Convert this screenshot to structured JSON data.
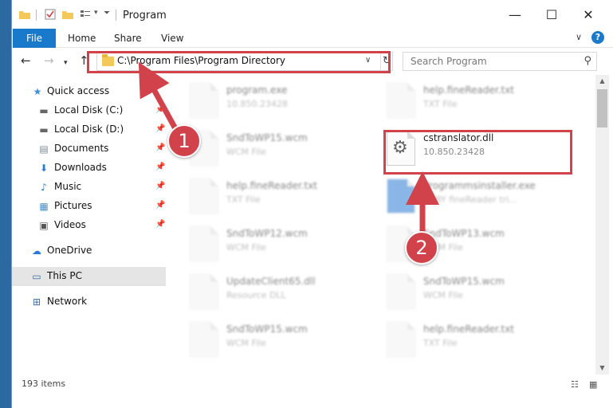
{
  "window": {
    "title": "Program",
    "controls": {
      "minimize": "—",
      "maximize": "☐",
      "close": "✕"
    }
  },
  "ribbon": {
    "tabs": [
      {
        "label": "File"
      },
      {
        "label": "Home"
      },
      {
        "label": "Share"
      },
      {
        "label": "View"
      }
    ]
  },
  "nav": {
    "address_path": "C:\\Program Files\\Program Directory",
    "search_placeholder": "Search Program"
  },
  "sidebar": {
    "items": [
      {
        "label": "Quick access",
        "icon": "star-icon",
        "pinned": false
      },
      {
        "label": "Local Disk (C:)",
        "icon": "drive-icon",
        "pinned": true
      },
      {
        "label": "Local Disk (D:)",
        "icon": "drive-icon",
        "pinned": true
      },
      {
        "label": "Documents",
        "icon": "documents-icon",
        "pinned": true
      },
      {
        "label": "Downloads",
        "icon": "download-icon",
        "pinned": true
      },
      {
        "label": "Music",
        "icon": "music-icon",
        "pinned": true
      },
      {
        "label": "Pictures",
        "icon": "pictures-icon",
        "pinned": true
      },
      {
        "label": "Videos",
        "icon": "videos-icon",
        "pinned": true
      },
      {
        "label": "OneDrive",
        "icon": "cloud-icon",
        "pinned": false
      },
      {
        "label": "This PC",
        "icon": "computer-icon",
        "pinned": false,
        "selected": true
      },
      {
        "label": "Network",
        "icon": "network-icon",
        "pinned": false
      }
    ]
  },
  "files": [
    {
      "name": "program.exe",
      "sub": "10.850.23428"
    },
    {
      "name": "help.fineReader.txt",
      "sub": "TXT File"
    },
    {
      "name": "SndToWP15.wcm",
      "sub": "WCM File"
    },
    {
      "name": "cstranslator.dll",
      "sub": "10.850.23428"
    },
    {
      "name": "help.fineReader.txt",
      "sub": "TXT File"
    },
    {
      "name": "Programmsinstaller.exe",
      "sub": "ABBY fineReader tri..."
    },
    {
      "name": "SndToWP12.wcm",
      "sub": "WCM File"
    },
    {
      "name": "SndToWP13.wcm",
      "sub": "WCM File"
    },
    {
      "name": "UpdateClient65.dll",
      "sub": "Resource DLL"
    },
    {
      "name": "SndToWP15.wcm",
      "sub": "WCM File"
    },
    {
      "name": "SndToWP15.wcm",
      "sub": "WCM File"
    },
    {
      "name": "help.fineReader.txt",
      "sub": "TXT File"
    }
  ],
  "status": {
    "item_count": "193 items"
  },
  "annotations": {
    "step1": "1",
    "step2": "2",
    "color": "#d2424a"
  }
}
